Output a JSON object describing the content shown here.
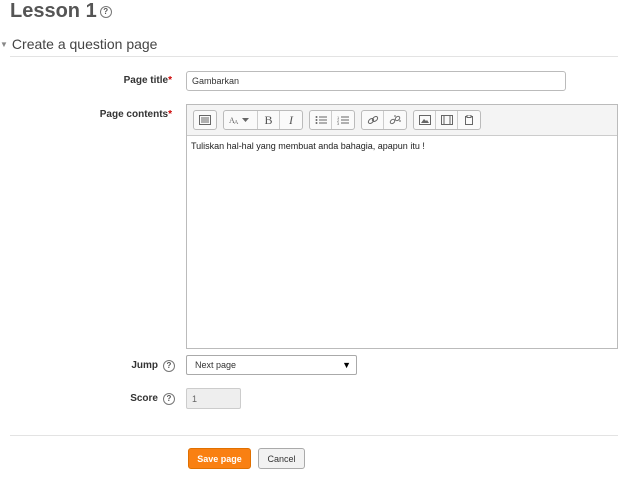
{
  "page": {
    "title": "Lesson 1",
    "help_glyph": "?"
  },
  "section": {
    "title": "Create a question page"
  },
  "form": {
    "page_title_label": "Page title",
    "page_title_value": "Gambarkan",
    "page_contents_label": "Page contents",
    "page_contents_text": "Tuliskan hal-hal yang membuat anda bahagia, apapun itu !",
    "jump_label": "Jump",
    "jump_value": "Next page",
    "score_label": "Score",
    "score_value": "1",
    "required_marker": "*"
  },
  "toolbar": {
    "icons": [
      "show-more-icon",
      "font-size-icon",
      "bold-icon",
      "italic-icon",
      "bullet-list-icon",
      "numbered-list-icon",
      "link-icon",
      "unlink-icon",
      "image-icon",
      "media-icon",
      "file-manager-icon"
    ],
    "bold": "B",
    "italic": "I"
  },
  "actions": {
    "save": "Save page",
    "cancel": "Cancel"
  },
  "colors": {
    "primary": "#f98012",
    "required": "#cc0000"
  }
}
